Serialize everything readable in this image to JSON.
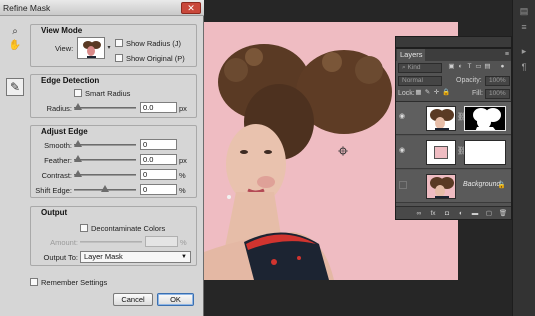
{
  "dialog": {
    "title": "Refine Mask",
    "close": "✕",
    "tools": [
      {
        "icon": "zoom-tool-icon",
        "glyph": "🔍"
      },
      {
        "icon": "hand-tool-icon",
        "glyph": "✋"
      },
      {
        "icon": "refine-radius-brush-icon",
        "glyph": "🖌"
      }
    ],
    "view_mode": {
      "title": "View Mode",
      "view_label": "View:",
      "show_radius": "Show Radius (J)",
      "show_original": "Show Original (P)"
    },
    "edge_detection": {
      "title": "Edge Detection",
      "smart_radius": "Smart Radius",
      "radius_label": "Radius:",
      "radius_value": "0.0",
      "radius_unit": "px",
      "radius_level": 0
    },
    "adjust_edge": {
      "title": "Adjust Edge",
      "smooth_label": "Smooth:",
      "smooth_value": "0",
      "smooth_level": 0,
      "feather_label": "Feather:",
      "feather_value": "0.0",
      "feather_unit": "px",
      "feather_level": 0,
      "contrast_label": "Contrast:",
      "contrast_value": "0",
      "contrast_unit": "%",
      "contrast_level": 0,
      "shift_label": "Shift Edge:",
      "shift_value": "0",
      "shift_unit": "%",
      "shift_level": 0.5
    },
    "output": {
      "title": "Output",
      "decontaminate": "Decontaminate Colors",
      "amount_label": "Amount:",
      "amount_unit": "%",
      "output_to_label": "Output To:",
      "output_to_value": "Layer Mask"
    },
    "remember": "Remember Settings",
    "cancel": "Cancel",
    "ok": "OK"
  },
  "layers": {
    "tab": "Layers",
    "kind_label": "Kind",
    "blend_mode": "Normal",
    "opacity_label": "Opacity:",
    "opacity_value": "100%",
    "lock_label": "Lock:",
    "fill_label": "Fill:",
    "fill_value": "100%",
    "background_name": "Background"
  },
  "colors": {
    "canvas_bg": "#efbcc2",
    "panel_bg": "#535353",
    "dialog_bg": "#d6d6d6",
    "close_red": "#c9483b",
    "swatch_pink": "#efbcc2"
  }
}
